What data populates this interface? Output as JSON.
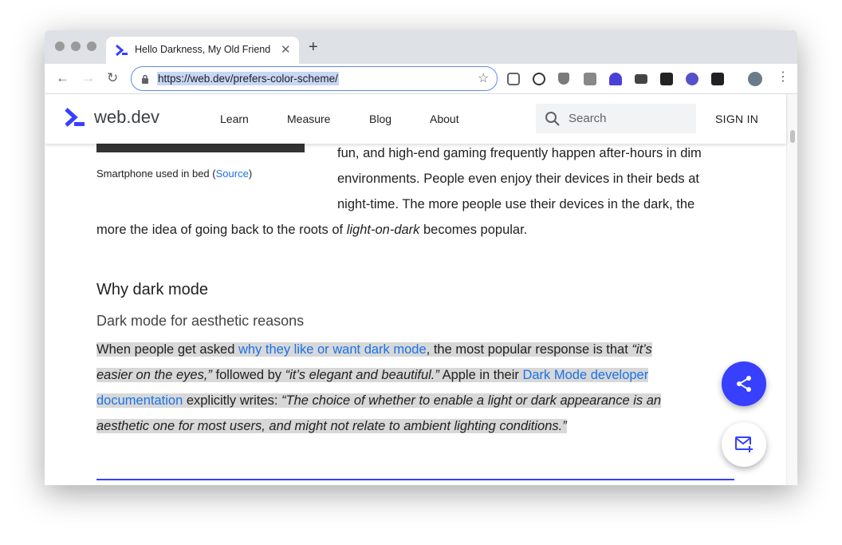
{
  "browser": {
    "tab_title": "Hello Darkness, My Old Friend",
    "url": "https://web.dev/prefers-color-scheme/"
  },
  "site": {
    "logo_text": "web.dev",
    "nav": [
      "Learn",
      "Measure",
      "Blog",
      "About"
    ],
    "search_placeholder": "Search",
    "sign_in": "SIGN IN"
  },
  "article": {
    "caption_text": "Smartphone used in bed (",
    "caption_link": "Source",
    "caption_end": ")",
    "intro_lines": [
      "fun, and high-end gaming frequently happen after-hours in dim",
      "environments. People even enjoy their devices in their beds at",
      "night-time. The more people use their devices in the dark, the"
    ],
    "intro_last_a": "more the idea of going back to the roots of ",
    "intro_last_em": "light-on-dark",
    "intro_last_b": " becomes popular.",
    "h2": "Why dark mode",
    "h3": "Dark mode for aesthetic reasons",
    "p1_a": "When people get asked ",
    "p1_link": "why they like or want dark mode",
    "p1_b": ", the most popular response is that ",
    "p1_em": "“it’s",
    "p2_em": "easier on the eyes,”",
    "p2_a": " followed by ",
    "p2_em2": "“it’s elegant and beautiful.”",
    "p2_b": " Apple in their ",
    "p2_link": "Dark Mode developer",
    "p3_link": "documentation",
    "p3_a": " explicitly writes: ",
    "p3_em": "“The choice of whether to enable a light or dark appearance is an",
    "p4_em": "aesthetic one for most users, and might not relate to ambient lighting conditions.”"
  },
  "colors": {
    "accent": "#3740ff",
    "link": "#1a73e8"
  }
}
